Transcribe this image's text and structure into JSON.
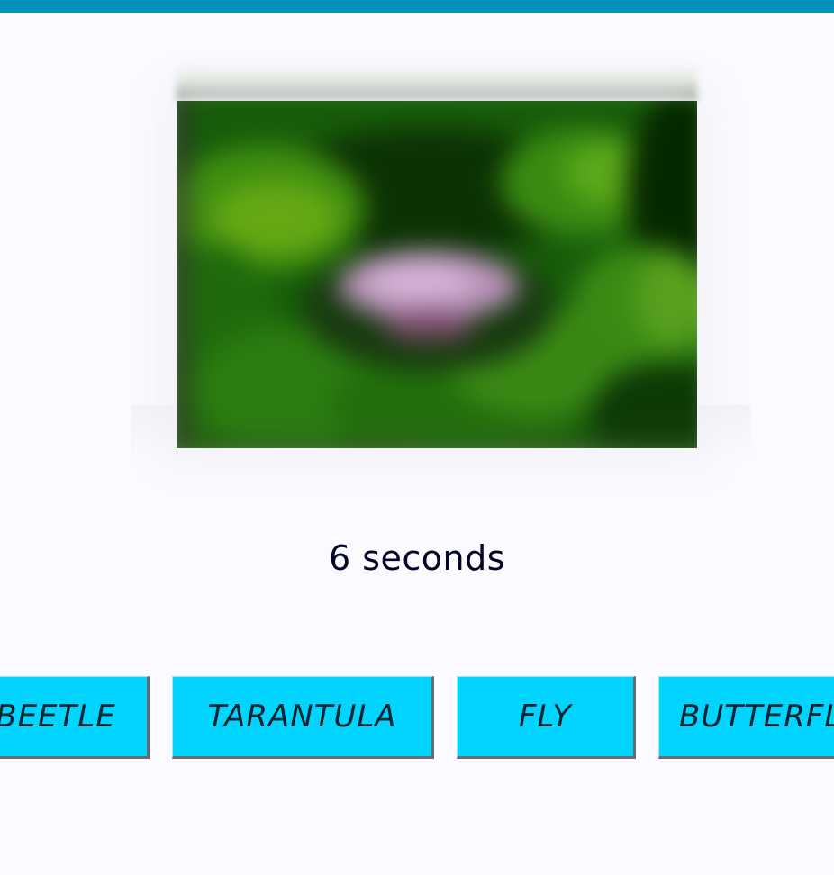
{
  "timer": {
    "text": "6 seconds"
  },
  "image": {
    "icon": "blurred-insect-photo",
    "colors": {
      "leaf_dark": "#0f3a06",
      "leaf_mid": "#2b7a12",
      "leaf_light": "#58a818",
      "flower": "#c7a0c8"
    }
  },
  "answers": [
    {
      "label": "BEETLE"
    },
    {
      "label": "TARANTULA"
    },
    {
      "label": "FLY"
    },
    {
      "label": "BUTTERFLY"
    }
  ],
  "colors": {
    "top_bar": "#0091bd",
    "button": "#00d4ff",
    "background": "#fafaff"
  }
}
